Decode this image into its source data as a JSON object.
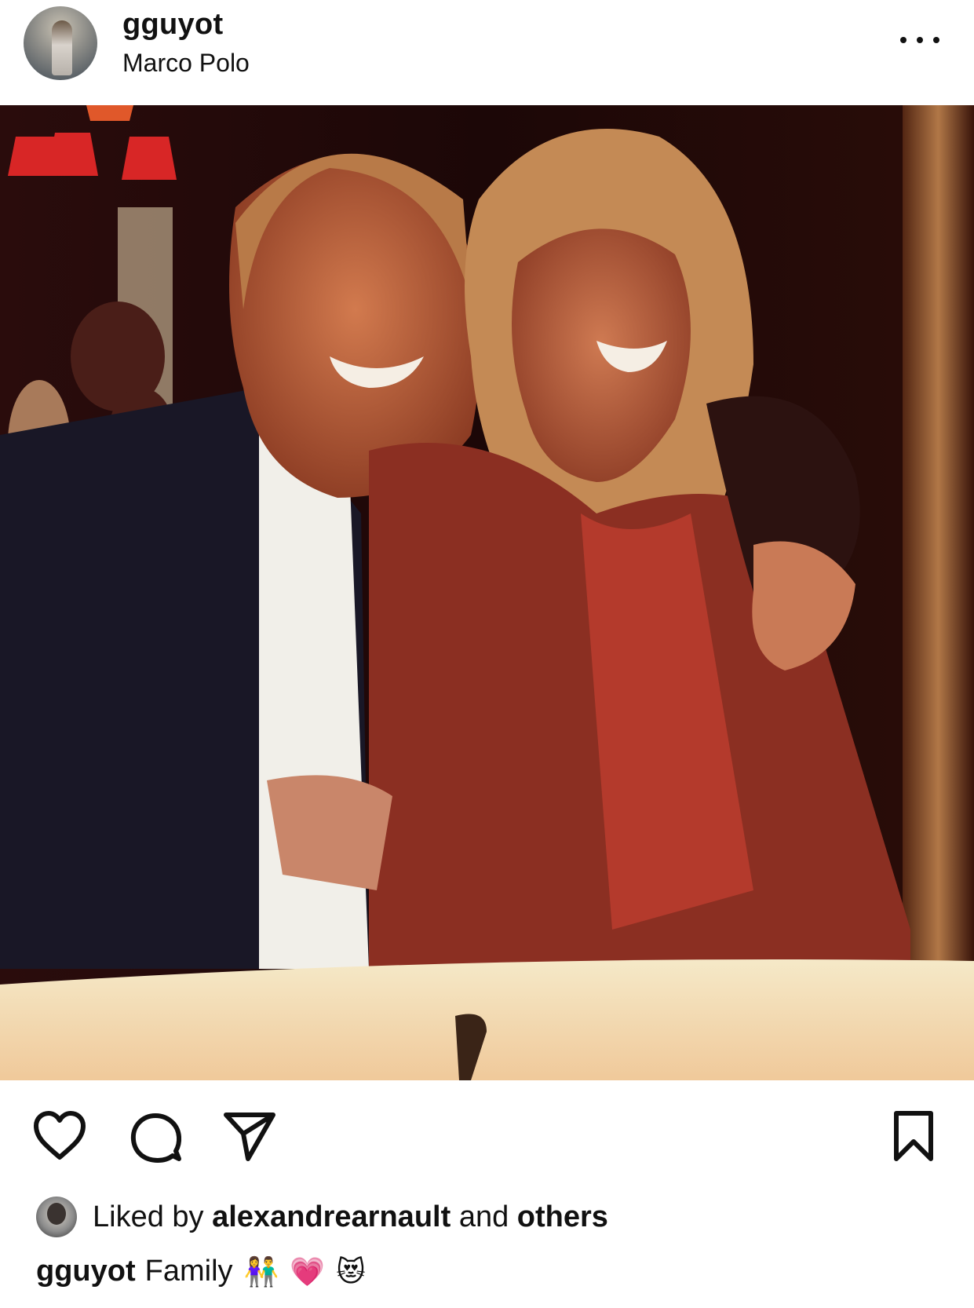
{
  "post": {
    "username": "gguyot",
    "location": "Marco Polo",
    "likes": {
      "prefix": "Liked by",
      "liker": "alexandrearnault",
      "middle": "and",
      "suffix": "others"
    },
    "caption": {
      "username": "gguyot",
      "text": "Family",
      "emojis": [
        "👫",
        "💗",
        "😻"
      ]
    }
  },
  "icons": {
    "more": "more-options-icon",
    "like": "heart-icon",
    "comment": "comment-icon",
    "share": "send-icon",
    "save": "bookmark-icon"
  },
  "colors": {
    "text": "#111111",
    "background": "#ffffff"
  }
}
